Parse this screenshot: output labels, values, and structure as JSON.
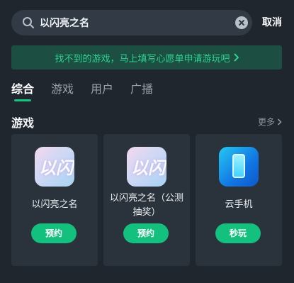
{
  "search": {
    "query": "以闪亮之名",
    "cancel_label": "取消"
  },
  "banner": {
    "text": "找不到的游戏，马上填写心愿单申请游玩吧"
  },
  "tabs": [
    {
      "label": "综合",
      "active": true
    },
    {
      "label": "游戏",
      "active": false
    },
    {
      "label": "用户",
      "active": false
    },
    {
      "label": "广播",
      "active": false
    }
  ],
  "section": {
    "title": "游戏",
    "more_label": "更多"
  },
  "games": [
    {
      "name": "以闪亮之名",
      "action": "预约",
      "icon": "game-art-icon"
    },
    {
      "name": "以闪亮之名（公测抽奖）",
      "action": "预约",
      "icon": "game-art-icon"
    },
    {
      "name": "云手机",
      "action": "秒玩",
      "icon": "cloud-phone-icon"
    }
  ],
  "colors": {
    "accent": "#14c07d",
    "background": "#1f262e",
    "card": "#2a323b",
    "banner_bg": "#1d4e42",
    "banner_text": "#2fd28f"
  }
}
